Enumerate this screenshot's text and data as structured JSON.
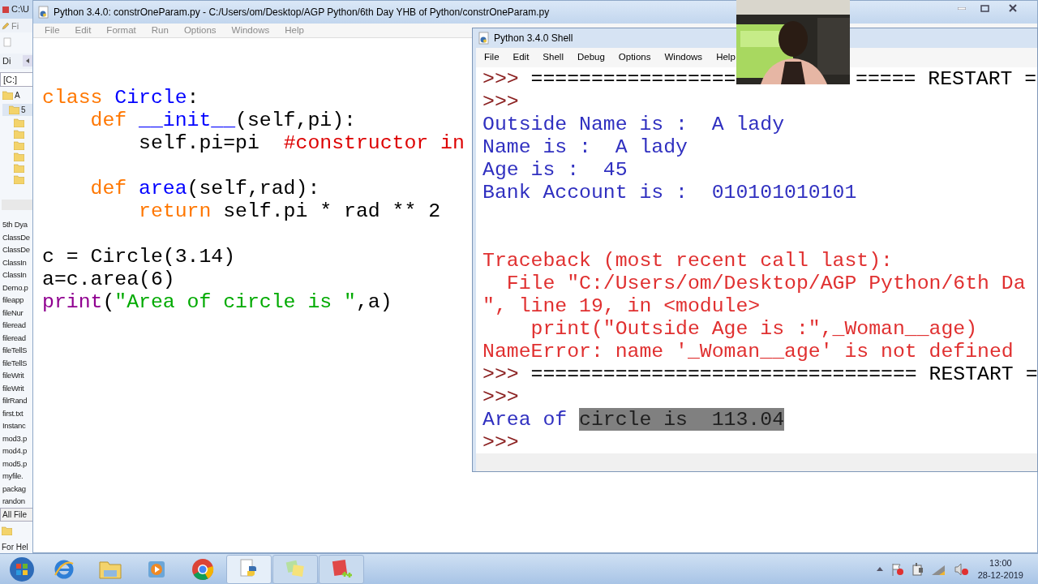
{
  "back_window": {
    "title": "C:\\U",
    "menu": "Fi",
    "tab": "Di",
    "drive": "[C:]",
    "tree": [
      "A",
      "5"
    ],
    "files": [
      "5th Dya",
      "ClassDe",
      "ClassDe",
      "ClassIn",
      "ClassIn",
      "Demo.p",
      "fileapp",
      "fileNur",
      "fileread",
      "fileread",
      "fileTellS",
      "fileTellS",
      "fileWrit",
      "fileWrit",
      "filrRand",
      "first.txt",
      "Instanc",
      "mod3.p",
      "mod4.p",
      "mod5.p",
      "myfile.",
      "packag",
      "randon"
    ],
    "filter": "All File",
    "status": "For Hel"
  },
  "editor": {
    "title": "Python 3.4.0: constrOneParam.py - C:/Users/om/Desktop/AGP Python/6th Day YHB of Python/constrOneParam.py",
    "menu": [
      "File",
      "Edit",
      "Format",
      "Run",
      "Options",
      "Windows",
      "Help"
    ],
    "lines": [
      {
        "kind": "code",
        "tokens": [
          {
            "text": "class ",
            "kind": "keyword"
          },
          {
            "text": "Circle",
            "kind": "name"
          },
          {
            "text": ":",
            "kind": "plain"
          }
        ]
      },
      {
        "kind": "code",
        "tokens": [
          {
            "text": "    def ",
            "kind": "keyword"
          },
          {
            "text": "__init__",
            "kind": "name"
          },
          {
            "text": "(self,pi):",
            "kind": "plain"
          }
        ]
      },
      {
        "kind": "code",
        "tokens": [
          {
            "text": "        self.pi=pi  ",
            "kind": "plain"
          },
          {
            "text": "#constructor in",
            "kind": "comment"
          }
        ]
      },
      {
        "kind": "blank"
      },
      {
        "kind": "code",
        "tokens": [
          {
            "text": "    def ",
            "kind": "keyword"
          },
          {
            "text": "area",
            "kind": "name"
          },
          {
            "text": "(self,rad):",
            "kind": "plain"
          }
        ]
      },
      {
        "kind": "code",
        "tokens": [
          {
            "text": "        return",
            "kind": "keyword"
          },
          {
            "text": " self.pi * rad ** 2",
            "kind": "plain"
          }
        ]
      },
      {
        "kind": "blank"
      },
      {
        "kind": "code",
        "tokens": [
          {
            "text": "c = Circle(3.14)",
            "kind": "plain"
          }
        ]
      },
      {
        "kind": "code",
        "tokens": [
          {
            "text": "a=c.area(6)",
            "kind": "plain"
          }
        ]
      },
      {
        "kind": "code",
        "tokens": [
          {
            "text": "print",
            "kind": "builtin"
          },
          {
            "text": "(",
            "kind": "plain"
          },
          {
            "text": "\"Area of circle is \"",
            "kind": "string"
          },
          {
            "text": ",a)",
            "kind": "plain"
          }
        ]
      }
    ]
  },
  "shell": {
    "title": "Python 3.4.0 Shell",
    "menu": [
      "File",
      "Edit",
      "Shell",
      "Debug",
      "Options",
      "Windows",
      "Help"
    ],
    "lines": [
      {
        "kind": "split",
        "left": [
          {
            "text": ">>> ",
            "kind": "prompt"
          },
          {
            "text": "=================",
            "kind": "plain"
          }
        ],
        "right": [
          {
            "text": "===== RESTART =",
            "kind": "plain"
          }
        ]
      },
      {
        "kind": "text",
        "segments": [
          {
            "text": ">>>",
            "kind": "prompt"
          }
        ]
      },
      {
        "kind": "text",
        "segments": [
          {
            "text": "Outside Name is :  A lady",
            "kind": "stdout"
          }
        ]
      },
      {
        "kind": "text",
        "segments": [
          {
            "text": "Name is :  A lady",
            "kind": "stdout"
          }
        ]
      },
      {
        "kind": "text",
        "segments": [
          {
            "text": "Age is :  45",
            "kind": "stdout"
          }
        ]
      },
      {
        "kind": "text",
        "segments": [
          {
            "text": "Bank Account is :  010101010101",
            "kind": "stdout"
          }
        ]
      },
      {
        "kind": "blank"
      },
      {
        "kind": "blank"
      },
      {
        "kind": "text",
        "segments": [
          {
            "text": "Traceback (most recent call last):",
            "kind": "error"
          }
        ]
      },
      {
        "kind": "text",
        "segments": [
          {
            "text": "  File \"C:/Users/om/Desktop/AGP Python/6th Da",
            "kind": "error"
          }
        ]
      },
      {
        "kind": "text",
        "segments": [
          {
            "text": "\", line 19, in <module>",
            "kind": "error"
          }
        ]
      },
      {
        "kind": "text",
        "segments": [
          {
            "text": "    print(\"Outside Age is :\",_Woman__age)",
            "kind": "error"
          }
        ]
      },
      {
        "kind": "text",
        "segments": [
          {
            "text": "NameError: name '_Woman__age' is not defined",
            "kind": "error"
          }
        ]
      },
      {
        "kind": "text",
        "segments": [
          {
            "text": ">>> ",
            "kind": "prompt"
          },
          {
            "text": "================================ RESTART =",
            "kind": "plain"
          }
        ]
      },
      {
        "kind": "text",
        "segments": [
          {
            "text": ">>>",
            "kind": "prompt"
          }
        ]
      },
      {
        "kind": "text",
        "segments": [
          {
            "text": "Area of ",
            "kind": "stdout",
            "selected": false
          },
          {
            "text": "circle is  113.04",
            "kind": "stdout",
            "selected": true
          }
        ]
      },
      {
        "kind": "text",
        "segments": [
          {
            "text": ">>>",
            "kind": "prompt"
          }
        ]
      }
    ]
  },
  "tray": {
    "time": "13:00",
    "date": "28-12-2019"
  }
}
